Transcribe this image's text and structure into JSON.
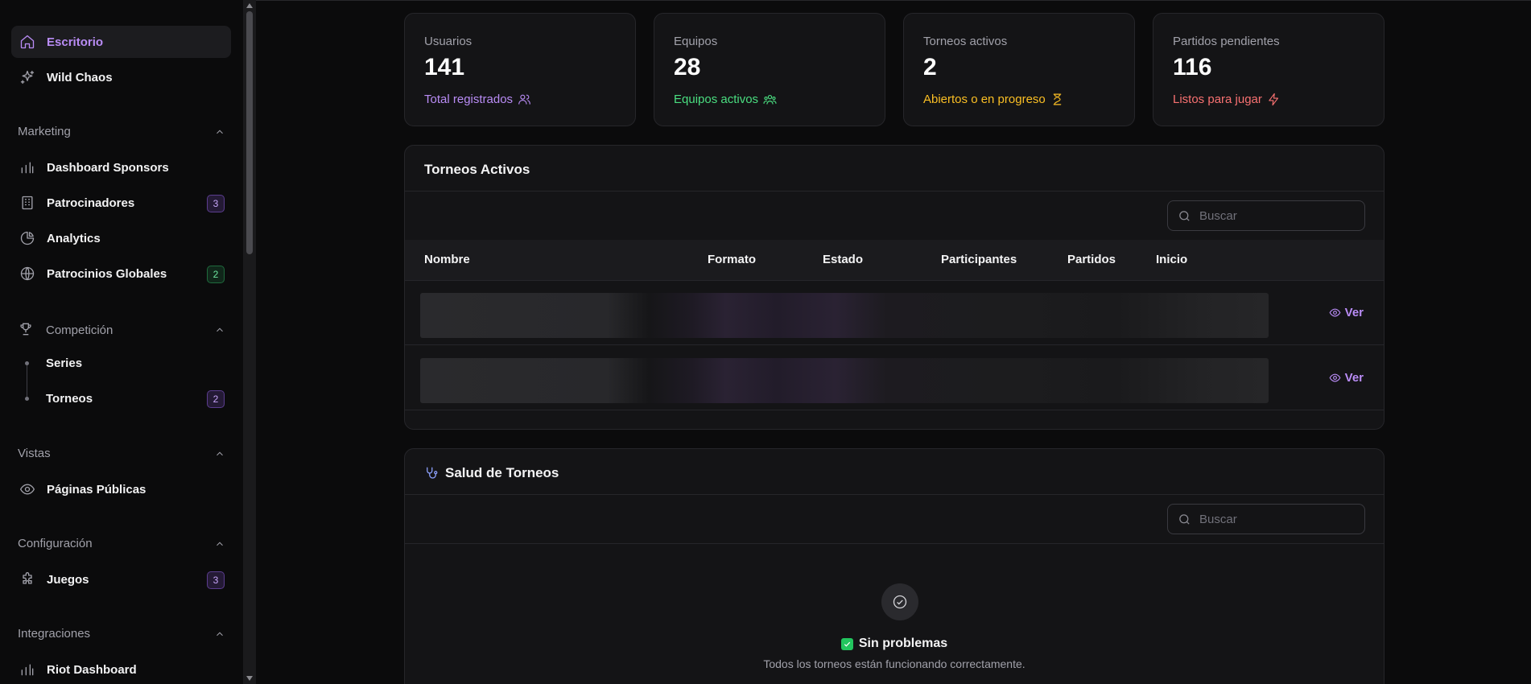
{
  "sidebar": {
    "items": {
      "escritorio": {
        "label": "Escritorio"
      },
      "wild_chaos": {
        "label": "Wild Chaos"
      }
    },
    "sections": {
      "marketing": {
        "title": "Marketing",
        "items": [
          {
            "label": "Dashboard Sponsors"
          },
          {
            "label": "Patrocinadores",
            "badge": "3"
          },
          {
            "label": "Analytics"
          },
          {
            "label": "Patrocinios Globales",
            "badge": "2"
          }
        ]
      },
      "competicion": {
        "title": "Competición",
        "items": [
          {
            "label": "Series"
          },
          {
            "label": "Torneos",
            "badge": "2"
          }
        ]
      },
      "vistas": {
        "title": "Vistas",
        "items": [
          {
            "label": "Páginas Públicas"
          }
        ]
      },
      "configuracion": {
        "title": "Configuración",
        "items": [
          {
            "label": "Juegos",
            "badge": "3"
          }
        ]
      },
      "integraciones": {
        "title": "Integraciones",
        "items": [
          {
            "label": "Riot Dashboard"
          }
        ]
      }
    }
  },
  "stats": [
    {
      "label": "Usuarios",
      "value": "141",
      "sub": "Total registrados",
      "color": "#b98cf5",
      "icon": "users-icon"
    },
    {
      "label": "Equipos",
      "value": "28",
      "sub": "Equipos activos",
      "color": "#4ade80",
      "icon": "team-icon"
    },
    {
      "label": "Torneos activos",
      "value": "2",
      "sub": "Abiertos o en progreso",
      "color": "#fbbf24",
      "icon": "hourglass-icon"
    },
    {
      "label": "Partidos pendientes",
      "value": "116",
      "sub": "Listos para jugar",
      "color": "#f87171",
      "icon": "bolt-icon"
    }
  ],
  "torneos": {
    "title": "Torneos Activos",
    "search_placeholder": "Buscar",
    "columns": [
      "Nombre",
      "Formato",
      "Estado",
      "Participantes",
      "Partidos",
      "Inicio"
    ],
    "action_label": "Ver"
  },
  "salud": {
    "title": "Salud de Torneos",
    "search_placeholder": "Buscar",
    "ok_title": "Sin problemas",
    "ok_text": "Todos los torneos están funcionando correctamente."
  },
  "colors": {
    "accent": "#b98cf5",
    "background": "#0b0b0c",
    "card": "#141416"
  }
}
